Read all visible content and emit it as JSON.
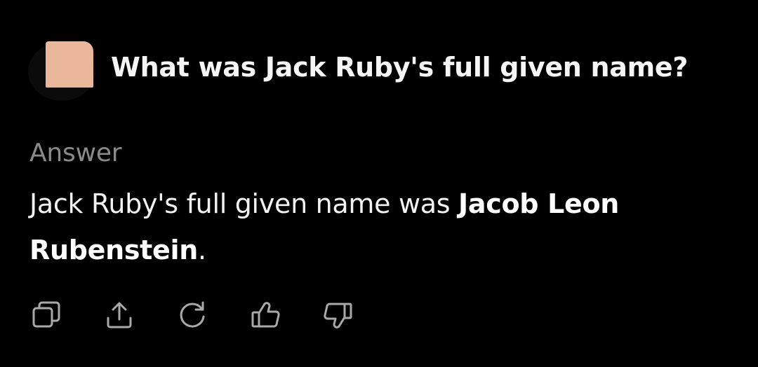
{
  "question": {
    "avatar_color": "#e9b79c",
    "text": "What was Jack Ruby's full given name?"
  },
  "answer": {
    "label": "Answer",
    "text_prefix": "Jack Ruby's full given name was ",
    "text_bold": "Jacob Leon Rubenstein",
    "text_suffix": "."
  },
  "actions": [
    {
      "icon": "copy-icon"
    },
    {
      "icon": "share-icon"
    },
    {
      "icon": "regenerate-icon"
    },
    {
      "icon": "thumbs-up-icon"
    },
    {
      "icon": "thumbs-down-icon"
    }
  ],
  "colors": {
    "background": "#000000",
    "text": "#f2f2f2",
    "muted_label": "#8a8a8a",
    "icon": "#a9a9a9"
  }
}
